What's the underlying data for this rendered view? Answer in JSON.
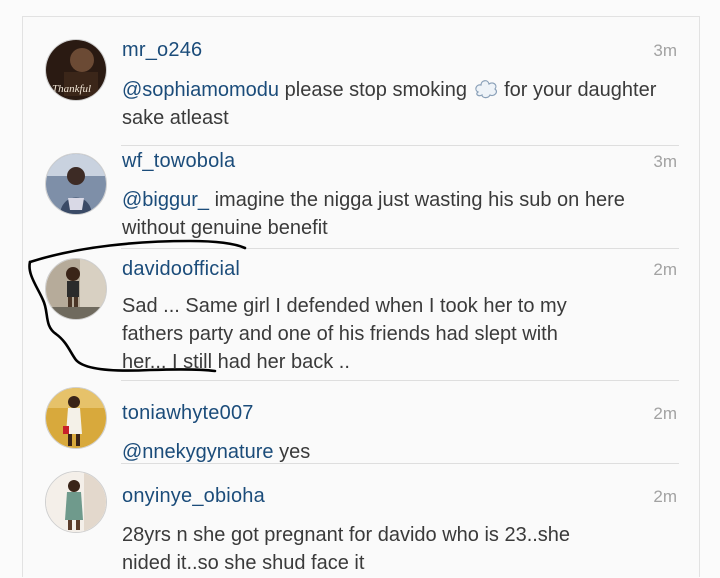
{
  "comments": [
    {
      "username": "mr_o246",
      "time": "3m",
      "mention": "@sophiamomodu",
      "text_before": "please stop smoking",
      "text_after": "for your daughter sake atleast",
      "emoji": "smoke-emoji",
      "avatar_text": "Thankful"
    },
    {
      "username": "wf_towobola",
      "time": "3m",
      "mention": "@biggur_",
      "text": "imagine the nigga just wasting his sub on here without genuine benefit"
    },
    {
      "username": "davidoofficial",
      "time": "2m",
      "text_line1": "Sad ... Same girl I defended when I took her to my",
      "text_line2": "fathers party and one of his friends had slept with",
      "text_line3": "her... I still had her back .."
    },
    {
      "username": "toniawhyte007",
      "time": "2m",
      "mention": "@nnekygynature",
      "text": "yes"
    },
    {
      "username": "onyinye_obioha",
      "time": "2m",
      "text_line1": "28yrs n she got pregnant for davido who is 23..she",
      "text_line2": "nided it..so she shud face it"
    }
  ],
  "colors": {
    "username": "#1b4c7a",
    "mention": "#1b4c7a",
    "time": "#a2a2a2",
    "body_text": "#3a3a3a",
    "scribble": "#000000"
  }
}
